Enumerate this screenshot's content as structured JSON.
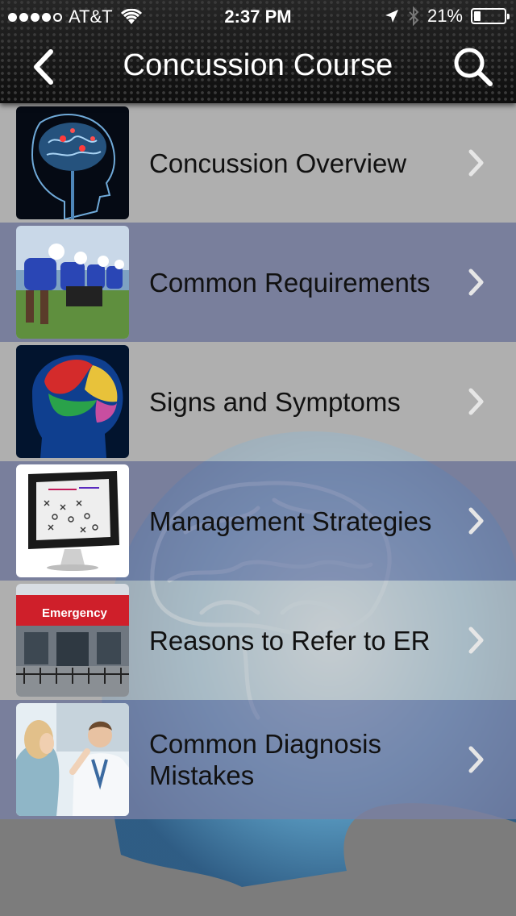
{
  "status_bar": {
    "carrier": "AT&T",
    "time": "2:37 PM",
    "battery_percent": "21%",
    "battery_level": 0.21,
    "signal_bars": 4
  },
  "nav": {
    "title": "Concussion Course",
    "back_icon": "chevron-left-icon",
    "search_icon": "search-icon"
  },
  "items": [
    {
      "label": "Concussion Overview",
      "thumb": "glowing brain x-ray head"
    },
    {
      "label": "Common Requirements",
      "thumb": "football players lined up"
    },
    {
      "label": "Signs and Symptoms",
      "thumb": "colored brain regions"
    },
    {
      "label": "Management Strategies",
      "thumb": "monitor with play diagram"
    },
    {
      "label": "Reasons to Refer to ER",
      "thumb": "emergency entrance",
      "sign_text": "Emergency"
    },
    {
      "label": "Common Diagnosis\nMistakes",
      "thumb": "doctor with patient"
    }
  ],
  "colors": {
    "row_light": "#c3c3c3",
    "row_dark": "#7880a5",
    "background": "#7c7c7c",
    "nav_bar": "#1c1c1c"
  }
}
